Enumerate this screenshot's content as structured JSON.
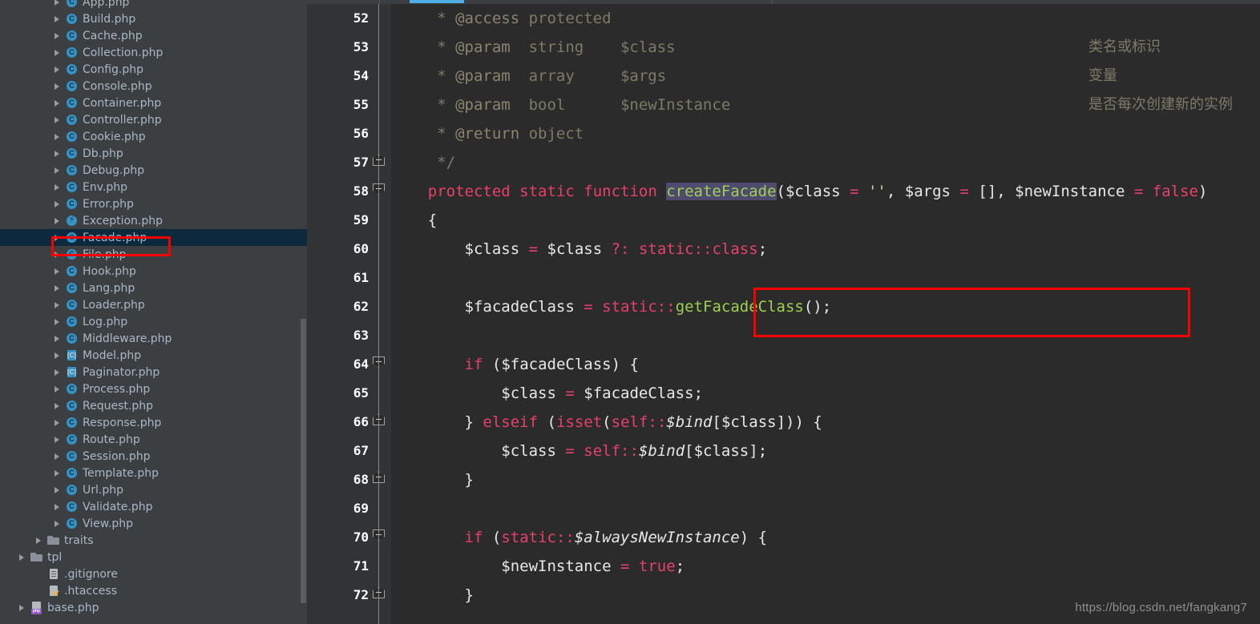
{
  "sidebar": {
    "scrollbar": {
      "name": "vertical-scrollbar"
    },
    "selected_item": "Facade.php",
    "highlight_color": "#f70000",
    "selection_row_color": "#0d293e",
    "items": [
      {
        "label": "App.php",
        "icon": "class-icon",
        "indent": 78,
        "expandable": true,
        "selected": false
      },
      {
        "label": "Build.php",
        "icon": "class-icon",
        "indent": 78,
        "expandable": true,
        "selected": false
      },
      {
        "label": "Cache.php",
        "icon": "class-icon",
        "indent": 78,
        "expandable": true,
        "selected": false
      },
      {
        "label": "Collection.php",
        "icon": "class-icon",
        "indent": 78,
        "expandable": true,
        "selected": false
      },
      {
        "label": "Config.php",
        "icon": "class-icon",
        "indent": 78,
        "expandable": true,
        "selected": false
      },
      {
        "label": "Console.php",
        "icon": "class-icon",
        "indent": 78,
        "expandable": true,
        "selected": false
      },
      {
        "label": "Container.php",
        "icon": "class-icon",
        "indent": 78,
        "expandable": true,
        "selected": false
      },
      {
        "label": "Controller.php",
        "icon": "class-icon",
        "indent": 78,
        "expandable": true,
        "selected": false
      },
      {
        "label": "Cookie.php",
        "icon": "class-icon",
        "indent": 78,
        "expandable": true,
        "selected": false
      },
      {
        "label": "Db.php",
        "icon": "class-icon",
        "indent": 78,
        "expandable": true,
        "selected": false
      },
      {
        "label": "Debug.php",
        "icon": "class-icon",
        "indent": 78,
        "expandable": true,
        "selected": false
      },
      {
        "label": "Env.php",
        "icon": "class-icon",
        "indent": 78,
        "expandable": true,
        "selected": false
      },
      {
        "label": "Error.php",
        "icon": "class-icon",
        "indent": 78,
        "expandable": true,
        "selected": false
      },
      {
        "label": "Exception.php",
        "icon": "exception-icon",
        "indent": 78,
        "expandable": true,
        "selected": false
      },
      {
        "label": "Facade.php",
        "icon": "class-icon",
        "indent": 78,
        "expandable": true,
        "selected": true
      },
      {
        "label": "File.php",
        "icon": "class-icon",
        "indent": 78,
        "expandable": true,
        "selected": false
      },
      {
        "label": "Hook.php",
        "icon": "class-icon",
        "indent": 78,
        "expandable": true,
        "selected": false
      },
      {
        "label": "Lang.php",
        "icon": "class-icon",
        "indent": 78,
        "expandable": true,
        "selected": false
      },
      {
        "label": "Loader.php",
        "icon": "class-icon",
        "indent": 78,
        "expandable": true,
        "selected": false
      },
      {
        "label": "Log.php",
        "icon": "class-icon",
        "indent": 78,
        "expandable": true,
        "selected": false
      },
      {
        "label": "Middleware.php",
        "icon": "class-icon",
        "indent": 78,
        "expandable": true,
        "selected": false
      },
      {
        "label": "Model.php",
        "icon": "abstract-class-icon",
        "indent": 78,
        "expandable": true,
        "selected": false
      },
      {
        "label": "Paginator.php",
        "icon": "abstract-class-icon",
        "indent": 78,
        "expandable": true,
        "selected": false
      },
      {
        "label": "Process.php",
        "icon": "class-icon",
        "indent": 78,
        "expandable": true,
        "selected": false
      },
      {
        "label": "Request.php",
        "icon": "class-icon",
        "indent": 78,
        "expandable": true,
        "selected": false
      },
      {
        "label": "Response.php",
        "icon": "class-icon",
        "indent": 78,
        "expandable": true,
        "selected": false
      },
      {
        "label": "Route.php",
        "icon": "class-icon",
        "indent": 78,
        "expandable": true,
        "selected": false
      },
      {
        "label": "Session.php",
        "icon": "class-icon",
        "indent": 78,
        "expandable": true,
        "selected": false
      },
      {
        "label": "Template.php",
        "icon": "class-icon",
        "indent": 78,
        "expandable": true,
        "selected": false
      },
      {
        "label": "Url.php",
        "icon": "class-icon",
        "indent": 78,
        "expandable": true,
        "selected": false
      },
      {
        "label": "Validate.php",
        "icon": "class-icon",
        "indent": 78,
        "expandable": true,
        "selected": false
      },
      {
        "label": "View.php",
        "icon": "class-icon",
        "indent": 78,
        "expandable": true,
        "selected": false
      },
      {
        "label": "traits",
        "icon": "folder-icon",
        "indent": 55,
        "expandable": true,
        "selected": false
      },
      {
        "label": "tpl",
        "icon": "folder-icon",
        "indent": 34,
        "expandable": true,
        "selected": false
      },
      {
        "label": ".gitignore",
        "icon": "file-icon",
        "indent": 55,
        "expandable": false,
        "selected": false
      },
      {
        "label": ".htaccess",
        "icon": "htaccess-icon",
        "indent": 55,
        "expandable": false,
        "selected": false
      },
      {
        "label": "base.php",
        "icon": "php-file-icon",
        "indent": 34,
        "expandable": true,
        "selected": false
      }
    ]
  },
  "editor": {
    "tab_accent_color": "#4eade5",
    "background": "#2b2b2b",
    "gutter_background": "#313335",
    "highlight_box_color": "#f70000",
    "selected_token": "createFacade",
    "line_numbers": [
      52,
      53,
      54,
      55,
      56,
      57,
      58,
      59,
      60,
      61,
      62,
      63,
      64,
      65,
      66,
      67,
      68,
      69,
      70,
      71,
      72
    ],
    "lines": [
      {
        "n": 52,
        "text": "     * @access protected"
      },
      {
        "n": 53,
        "text": "     * @param  string    $class",
        "comment": "类名或标识"
      },
      {
        "n": 54,
        "text": "     * @param  array     $args",
        "comment": "变量"
      },
      {
        "n": 55,
        "text": "     * @param  bool      $newInstance",
        "comment": "是否每次创建新的实例"
      },
      {
        "n": 56,
        "text": "     * @return object"
      },
      {
        "n": 57,
        "text": "     */",
        "fold": "open"
      },
      {
        "n": 58,
        "text": "    protected static function createFacade($class = '', $args = [], $newInstance = false)",
        "fold": "close"
      },
      {
        "n": 59,
        "text": "    {"
      },
      {
        "n": 60,
        "text": "        $class = $class ?: static::class;"
      },
      {
        "n": 61,
        "text": ""
      },
      {
        "n": 62,
        "text": "        $facadeClass = static::getFacadeClass();",
        "boxed": true
      },
      {
        "n": 63,
        "text": ""
      },
      {
        "n": 64,
        "text": "        if ($facadeClass) {",
        "fold": "close"
      },
      {
        "n": 65,
        "text": "            $class = $facadeClass;"
      },
      {
        "n": 66,
        "text": "        } elseif (isset(self::$bind[$class])) {",
        "fold": "open"
      },
      {
        "n": 67,
        "text": "            $class = self::$bind[$class];"
      },
      {
        "n": 68,
        "text": "        }",
        "fold": "open"
      },
      {
        "n": 69,
        "text": ""
      },
      {
        "n": 70,
        "text": "        if (static::$alwaysNewInstance) {",
        "fold": "close"
      },
      {
        "n": 71,
        "text": "            $newInstance = true;"
      },
      {
        "n": 72,
        "text": "        }",
        "fold": "open"
      }
    ],
    "chinese_comments": [
      "类名或标识",
      "变量",
      "是否每次创建新的实例"
    ]
  },
  "watermark": {
    "text": "https://blog.csdn.net/fangkang7"
  }
}
